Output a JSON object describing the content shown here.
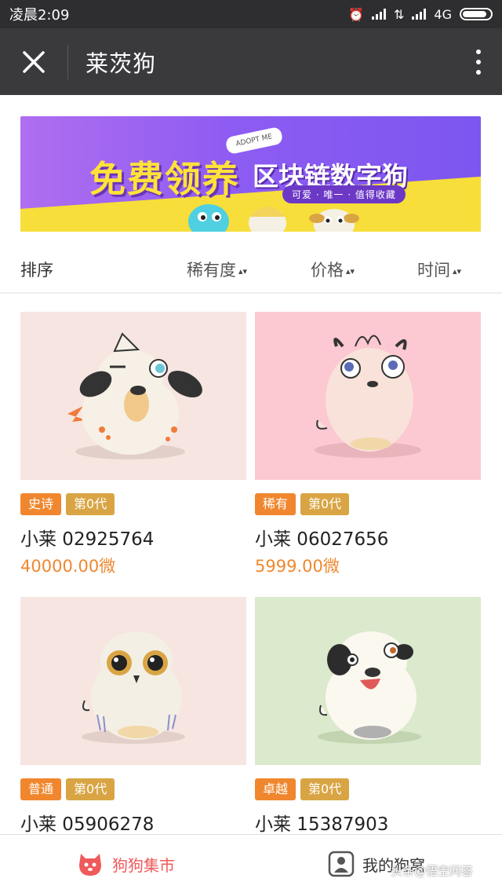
{
  "status_bar": {
    "time": "凌晨2:09",
    "network": "4G"
  },
  "app_bar": {
    "title": "莱茨狗"
  },
  "banner": {
    "text_free": "免费领养",
    "text_main": "区块链数字狗",
    "tagline": "可爱 · 唯一 · 值得收藏",
    "sign_text": "ADOPT ME"
  },
  "sort": {
    "label": "排序",
    "options": [
      {
        "label": "稀有度"
      },
      {
        "label": "价格"
      },
      {
        "label": "时间"
      }
    ]
  },
  "listings": [
    {
      "rarity": "史诗",
      "generation": "第0代",
      "name": "小莱 02925764",
      "price": "40000.00微",
      "bg": "#f6e5e1"
    },
    {
      "rarity": "稀有",
      "generation": "第0代",
      "name": "小莱 06027656",
      "price": "5999.00微",
      "bg": "#fcc8d1"
    },
    {
      "rarity": "普通",
      "generation": "第0代",
      "name": "小莱 05906278",
      "price": "",
      "bg": "#f6e5e1"
    },
    {
      "rarity": "卓越",
      "generation": "第0代",
      "name": "小莱 15387903",
      "price": "",
      "bg": "#dbe9cc"
    }
  ],
  "tab_bar": {
    "market": {
      "label": "狗狗集市",
      "icon": "dog-face-icon"
    },
    "my_kennel": {
      "label": "我的狗窝",
      "icon": "user-icon"
    }
  },
  "watermark": "头条@悟空问答",
  "colors": {
    "accent": "#f05a5a",
    "rarity_tag": "#f0872e",
    "generation_tag": "#d9a544",
    "price": "#f0872e"
  }
}
